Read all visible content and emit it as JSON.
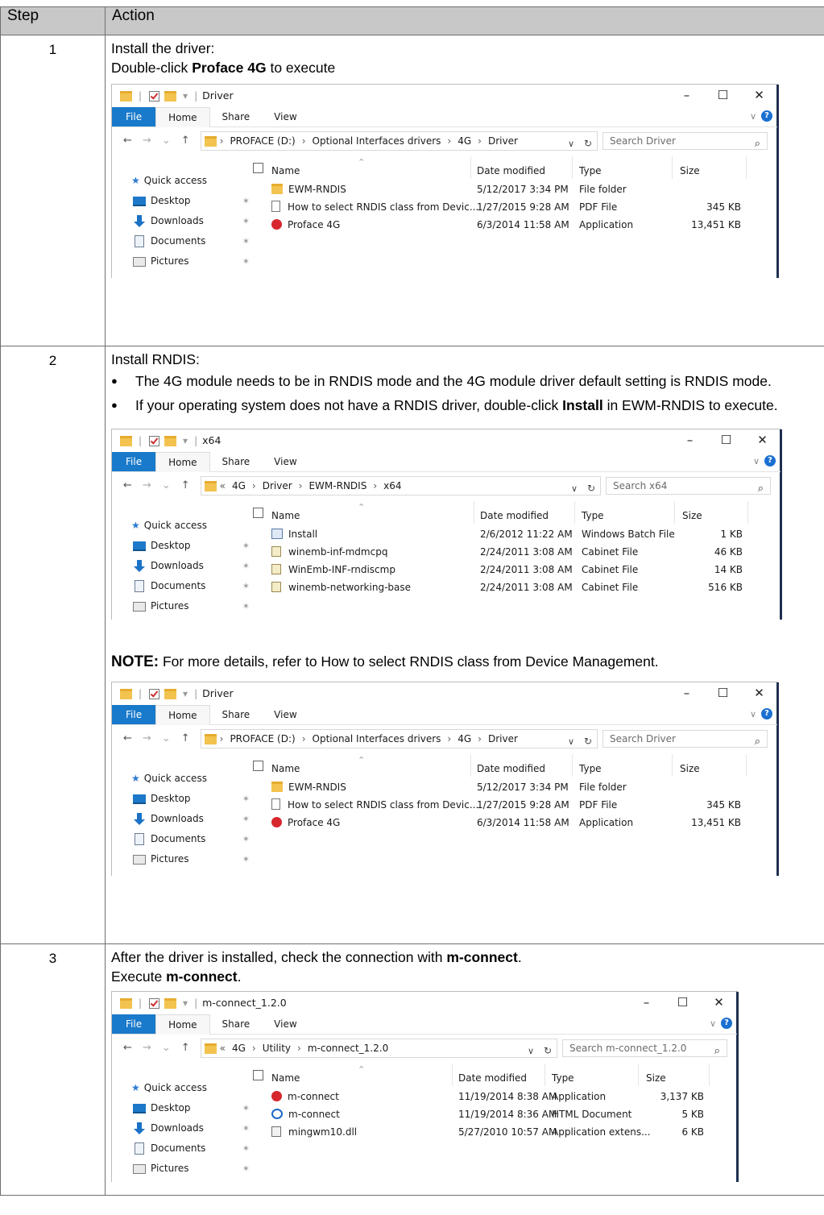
{
  "headers": {
    "step": "Step",
    "action": "Action"
  },
  "steps": [
    {
      "num": "1",
      "lines": [
        "Install the driver:"
      ],
      "line2_prefix": "Double-click ",
      "line2_bold": "Proface 4G",
      "line2_suffix": " to execute"
    },
    {
      "num": "2",
      "intro": "Install RNDIS:",
      "bullet1": "The 4G module needs to be in RNDIS mode and the 4G module driver default setting is RNDIS mode.",
      "bullet2_prefix": "If your operating system does not have a RNDIS driver, double-click ",
      "bullet2_bold": "Install",
      "bullet2_suffix": " in EWM-RNDIS to execute.",
      "note_label": "NOTE:",
      "note_text": " For more details, refer to How to select RNDIS class from Device Management."
    },
    {
      "num": "3",
      "line1_prefix": "After the driver is installed, check the connection with ",
      "line1_bold": "m-connect",
      "line1_suffix": ".",
      "line2_prefix": "Execute ",
      "line2_bold": "m-connect",
      "line2_suffix": "."
    }
  ],
  "explorer_common": {
    "ribbon": {
      "file": "File",
      "home": "Home",
      "share": "Share",
      "view": "View"
    },
    "columns": {
      "name": "Name",
      "date": "Date modified",
      "type": "Type",
      "size": "Size"
    },
    "sidebar": {
      "quick_access": "Quick access",
      "desktop": "Desktop",
      "downloads": "Downloads",
      "documents": "Documents",
      "pictures": "Pictures"
    },
    "controls": {
      "minimize": "–",
      "maximize": "☐",
      "close": "✕"
    }
  },
  "win_driver": {
    "title": "Driver",
    "path": [
      "PROFACE (D:)",
      "Optional Interfaces drivers",
      "4G",
      "Driver"
    ],
    "search_placeholder": "Search Driver",
    "files": [
      {
        "icon": "folder",
        "name": "EWM-RNDIS",
        "date": "5/12/2017 3:34 PM",
        "type": "File folder",
        "size": ""
      },
      {
        "icon": "pdf",
        "name": "How to select RNDIS class from Devic...",
        "date": "1/27/2015 9:28 AM",
        "type": "PDF File",
        "size": "345 KB"
      },
      {
        "icon": "app",
        "name": "Proface 4G",
        "date": "6/3/2014 11:58 AM",
        "type": "Application",
        "size": "13,451 KB"
      }
    ]
  },
  "win_x64": {
    "title": "x64",
    "path": [
      "«",
      "4G",
      "Driver",
      "EWM-RNDIS",
      "x64"
    ],
    "search_placeholder": "Search x64",
    "files": [
      {
        "icon": "bat",
        "name": "Install",
        "date": "2/6/2012 11:22 AM",
        "type": "Windows Batch File",
        "size": "1 KB"
      },
      {
        "icon": "cab",
        "name": "winemb-inf-mdmcpq",
        "date": "2/24/2011 3:08 AM",
        "type": "Cabinet File",
        "size": "46 KB"
      },
      {
        "icon": "cab",
        "name": "WinEmb-INF-rndiscmp",
        "date": "2/24/2011 3:08 AM",
        "type": "Cabinet File",
        "size": "14 KB"
      },
      {
        "icon": "cab",
        "name": "winemb-networking-base",
        "date": "2/24/2011 3:08 AM",
        "type": "Cabinet File",
        "size": "516 KB"
      }
    ]
  },
  "win_mconnect": {
    "title": "m-connect_1.2.0",
    "path": [
      "«",
      "4G",
      "Utility",
      "m-connect_1.2.0"
    ],
    "search_placeholder": "Search m-connect_1.2.0",
    "files": [
      {
        "icon": "app",
        "name": "m-connect",
        "date": "11/19/2014 8:38 AM",
        "type": "Application",
        "size": "3,137 KB"
      },
      {
        "icon": "html",
        "name": "m-connect",
        "date": "11/19/2014 8:36 AM",
        "type": "HTML Document",
        "size": "5 KB"
      },
      {
        "icon": "dll",
        "name": "mingwm10.dll",
        "date": "5/27/2010 10:57 AM",
        "type": "Application extens...",
        "size": "6 KB"
      }
    ]
  }
}
